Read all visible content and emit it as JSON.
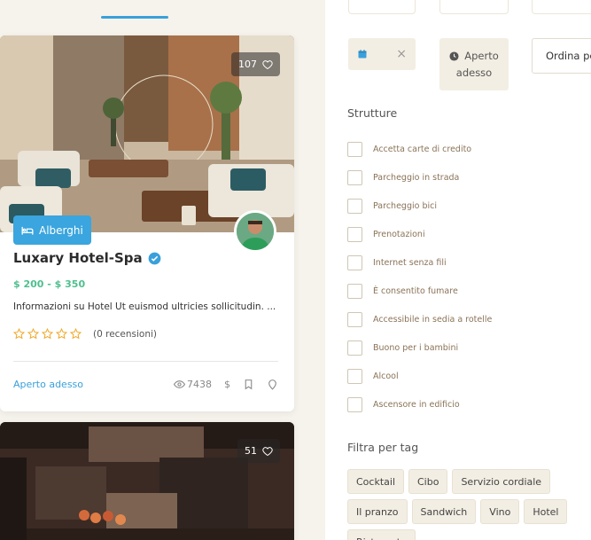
{
  "listings": [
    {
      "likes": "107",
      "category": "Alberghi",
      "title": "Luxary Hotel-Spa",
      "price": "$ 200 - $ 350",
      "description": "Informazioni su Hotel Ut euismod ultricies sollicitudin. ...",
      "rating": 0,
      "reviews": "(0 recensioni)",
      "status": "Aperto adesso",
      "views": "7438",
      "price_icon": "$"
    },
    {
      "likes": "51"
    }
  ],
  "filters": {
    "date_clear": "×",
    "open_now_line1": "Aperto",
    "open_now_line2": "adesso",
    "order_label": "Ordina per",
    "features_title": "Strutture",
    "features": [
      "Accetta carte di credito",
      "Parcheggio in strada",
      "Parcheggio bici",
      "Prenotazioni",
      "Internet senza fili",
      "È consentito fumare",
      "Accessibile in sedia a rotelle",
      "Buono per i bambini",
      "Alcool",
      "Ascensore in edificio"
    ],
    "tags_title": "Filtra per tag",
    "tags": [
      "Cocktail",
      "Cibo",
      "Servizio cordiale",
      "Il pranzo",
      "Sandwich",
      "Vino",
      "Hotel",
      "Ristorante"
    ]
  },
  "colors": {
    "accent": "#3aa0db",
    "price": "#4fbf8e",
    "feature_text": "#8a7358"
  }
}
